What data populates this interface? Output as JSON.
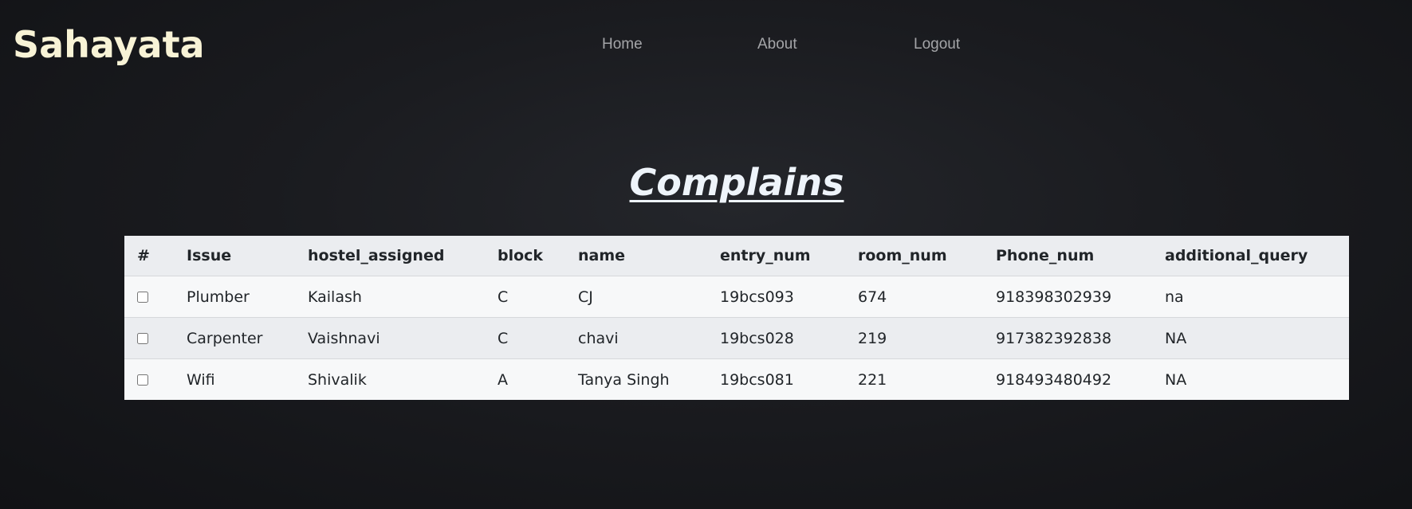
{
  "brand": {
    "title": "Sahayata"
  },
  "nav": {
    "items": [
      {
        "label": "Home"
      },
      {
        "label": "About"
      },
      {
        "label": "Logout"
      }
    ]
  },
  "main": {
    "title": "Complains",
    "table": {
      "headers": [
        "#",
        "Issue",
        "hostel_assigned",
        "block",
        "name",
        "entry_num",
        "room_num",
        "Phone_num",
        "additional_query"
      ],
      "rows": [
        {
          "checked": false,
          "issue": "Plumber",
          "hostel": "Kailash",
          "block": "C",
          "name": "CJ",
          "entry": "19bcs093",
          "room": "674",
          "phone": "918398302939",
          "query": "na"
        },
        {
          "checked": false,
          "issue": "Carpenter",
          "hostel": "Vaishnavi",
          "block": "C",
          "name": "chavi",
          "entry": "19bcs028",
          "room": "219",
          "phone": "917382392838",
          "query": "NA"
        },
        {
          "checked": false,
          "issue": "Wifi",
          "hostel": "Shivalik",
          "block": "A",
          "name": "Tanya Singh",
          "entry": "19bcs081",
          "room": "221",
          "phone": "918493480492",
          "query": "NA"
        }
      ]
    }
  }
}
